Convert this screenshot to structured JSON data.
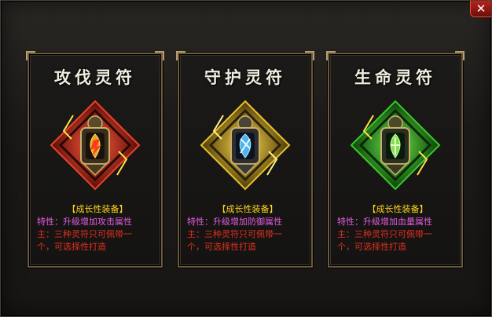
{
  "window": {
    "close_label": "✕",
    "close_icon": "close-icon"
  },
  "cards": [
    {
      "title": "攻伐灵符",
      "tag": "【成长性装备】",
      "trait": "特性：升级增加攻击属性",
      "note_line1": "主：三种灵符只可佩带一",
      "note_line2": "个，可选择性打造",
      "theme_color": "#c0281c",
      "gem_color": "#e8a21a",
      "icon": "attack-talisman-icon"
    },
    {
      "title": "守护灵符",
      "tag": "【成长性装备】",
      "trait": "特性：升级增加防御属性",
      "note_line1": "主：三种灵符只可佩带一",
      "note_line2": "个，可选择性打造",
      "theme_color": "#c8a020",
      "gem_color": "#4ab4f0",
      "icon": "guard-talisman-icon"
    },
    {
      "title": "生命灵符",
      "tag": "【成长性装备】",
      "trait": "特性：升级增加血量属性",
      "note_line1": "主：三种灵符只可佩带一",
      "note_line2": "个，可选择性打造",
      "theme_color": "#28a028",
      "gem_color": "#7ee24a",
      "icon": "life-talisman-icon"
    }
  ]
}
